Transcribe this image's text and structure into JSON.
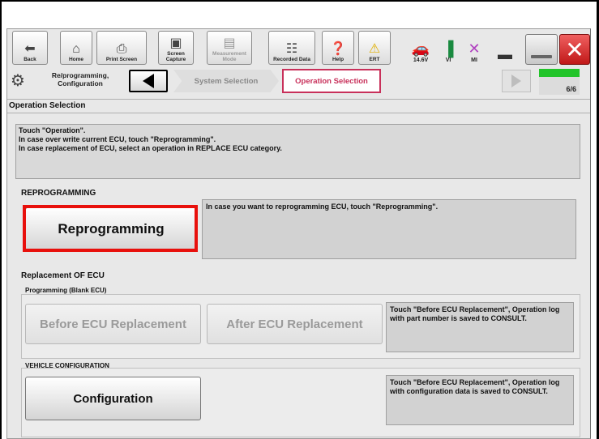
{
  "toolbar": {
    "back": "Back",
    "home": "Home",
    "print_screen": "Print Screen",
    "screen_capture": "Screen Capture",
    "measurement_mode": "Measurement Mode",
    "recorded_data": "Recorded Data",
    "help": "Help",
    "ert": "ERT",
    "voltage": "14.6V",
    "vi": "VI",
    "mi": "MI"
  },
  "nav": {
    "reprog_label": "Re/programming, Configuration",
    "crumb_system": "System Selection",
    "crumb_operation": "Operation Selection",
    "progress": "6/6",
    "progress_fraction": 1.0
  },
  "page": {
    "title": "Operation Selection",
    "instructions": [
      "Touch \"Operation\".",
      "In case over write current ECU, touch \"Reprogramming\".",
      "In case replacement of ECU, select an operation in REPLACE ECU category."
    ]
  },
  "reprogramming": {
    "heading": "REPROGRAMMING",
    "button": "Reprogramming",
    "description": "In case you want to reprogramming ECU, touch \"Reprogramming\"."
  },
  "replacement": {
    "heading": "Replacement OF ECU",
    "programming_heading": "Programming (Blank ECU)",
    "before_button": "Before ECU Replacement",
    "after_button": "After ECU Replacement",
    "programming_description": "Touch \"Before ECU Replacement\", Operation log with part number is saved to CONSULT.",
    "vehicle_config_heading": "VEHICLE CONFIGURATION",
    "config_button": "Configuration",
    "config_description": "Touch \"Before ECU Replacement\", Operation log with configuration data is saved to CONSULT."
  },
  "colors": {
    "highlight": "#e8100c",
    "breadcrumb_active": "#c8305a",
    "progress": "#22c42a",
    "close": "#d02020"
  }
}
